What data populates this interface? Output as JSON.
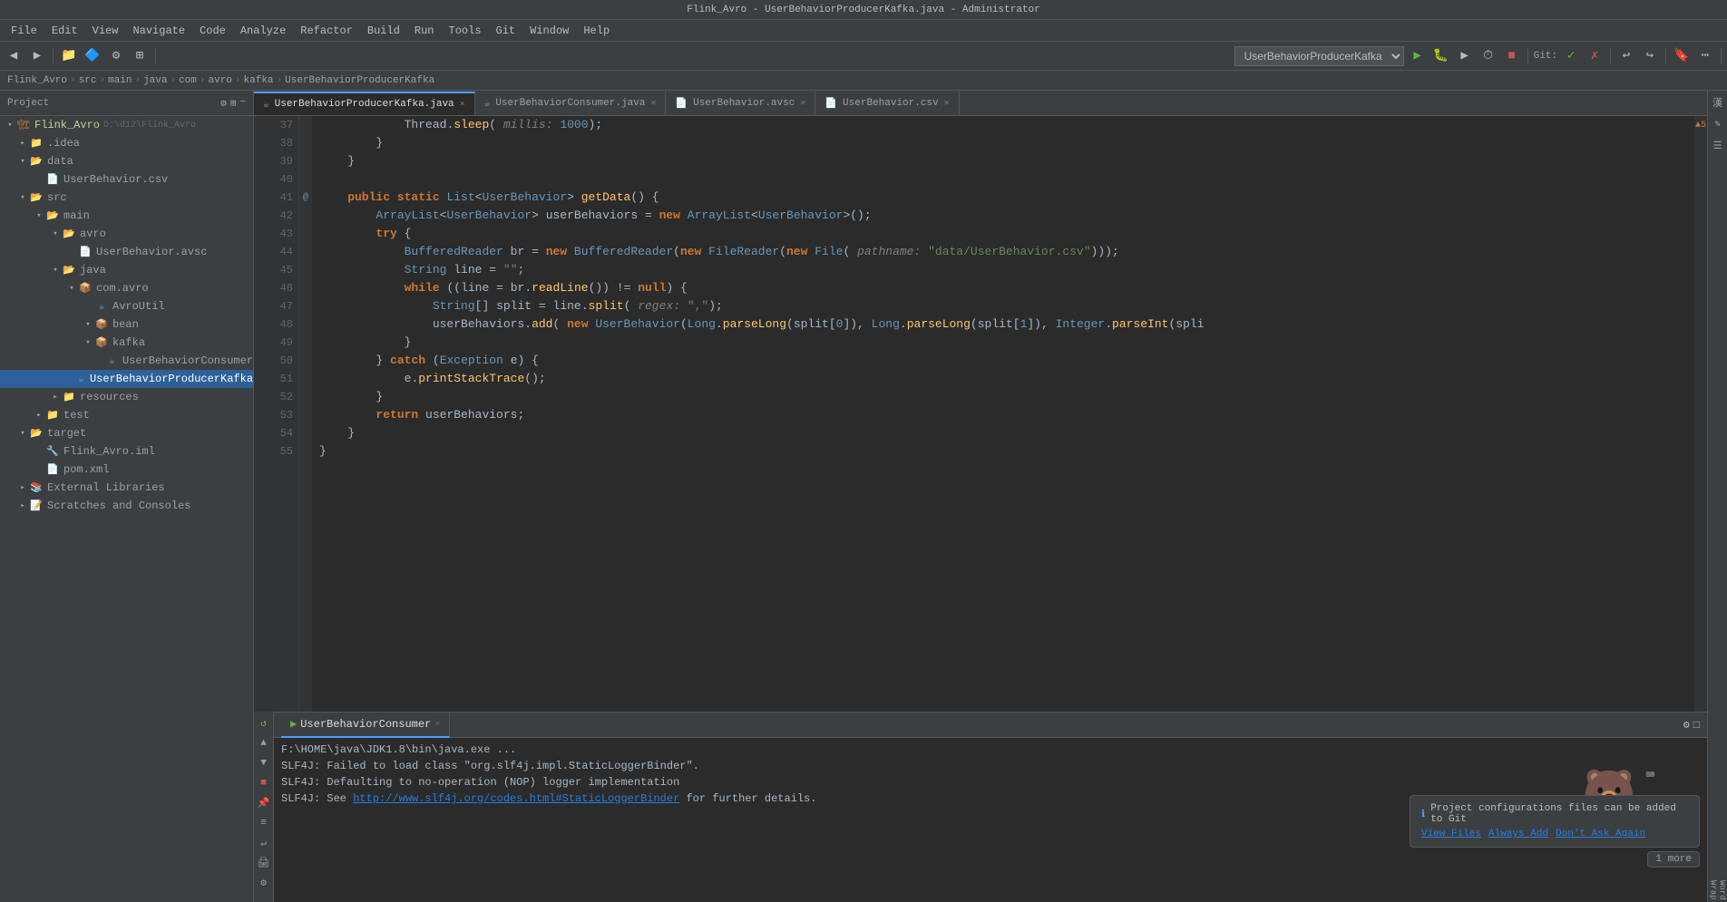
{
  "titleBar": {
    "title": "Flink_Avro - UserBehaviorProducerKafka.java - Administrator"
  },
  "menuBar": {
    "items": [
      "File",
      "Edit",
      "View",
      "Navigate",
      "Code",
      "Analyze",
      "Refactor",
      "Build",
      "Run",
      "Tools",
      "Git",
      "Window",
      "Help"
    ]
  },
  "breadcrumb": {
    "items": [
      "Flink_Avro",
      "src",
      "main",
      "java",
      "com",
      "avro",
      "kafka",
      "UserBehaviorProducerKafka"
    ]
  },
  "sidebar": {
    "header": "Project",
    "tree": [
      {
        "id": "flink_avro",
        "label": "Flink_Avro",
        "path": "D:\\d12\\Flink_Avro",
        "level": 0,
        "expanded": true,
        "type": "project"
      },
      {
        "id": "idea",
        "label": ".idea",
        "level": 1,
        "expanded": false,
        "type": "folder"
      },
      {
        "id": "data",
        "label": "data",
        "level": 1,
        "expanded": true,
        "type": "folder"
      },
      {
        "id": "userbehavior_csv",
        "label": "UserBehavior.csv",
        "level": 2,
        "expanded": false,
        "type": "csv"
      },
      {
        "id": "src",
        "label": "src",
        "level": 1,
        "expanded": true,
        "type": "folder"
      },
      {
        "id": "main",
        "label": "main",
        "level": 2,
        "expanded": true,
        "type": "folder"
      },
      {
        "id": "avro_folder",
        "label": "avro",
        "level": 3,
        "expanded": true,
        "type": "folder"
      },
      {
        "id": "userbehavior_avsc",
        "label": "UserBehavior.avsc",
        "level": 4,
        "expanded": false,
        "type": "avsc"
      },
      {
        "id": "java_folder",
        "label": "java",
        "level": 3,
        "expanded": true,
        "type": "folder"
      },
      {
        "id": "com_folder",
        "label": "com.avro",
        "level": 4,
        "expanded": true,
        "type": "package"
      },
      {
        "id": "avroutil",
        "label": "AvroUtil",
        "level": 5,
        "expanded": false,
        "type": "java"
      },
      {
        "id": "bean",
        "label": "bean",
        "level": 5,
        "expanded": true,
        "type": "package"
      },
      {
        "id": "kafka_pkg",
        "label": "kafka",
        "level": 5,
        "expanded": true,
        "type": "package"
      },
      {
        "id": "userbehaviorconsumer",
        "label": "UserBehaviorConsumer",
        "level": 6,
        "expanded": false,
        "type": "java"
      },
      {
        "id": "userbehaviorproducer",
        "label": "UserBehaviorProducerKafka",
        "level": 6,
        "expanded": false,
        "type": "java",
        "selected": true
      },
      {
        "id": "resources",
        "label": "resources",
        "level": 3,
        "expanded": false,
        "type": "folder"
      },
      {
        "id": "test",
        "label": "test",
        "level": 2,
        "expanded": false,
        "type": "folder"
      },
      {
        "id": "target",
        "label": "target",
        "level": 1,
        "expanded": true,
        "type": "folder"
      },
      {
        "id": "flink_avro_iml",
        "label": "Flink_Avro.iml",
        "level": 2,
        "expanded": false,
        "type": "iml"
      },
      {
        "id": "pom_xml",
        "label": "pom.xml",
        "level": 2,
        "expanded": false,
        "type": "xml"
      },
      {
        "id": "external_libs",
        "label": "External Libraries",
        "level": 1,
        "expanded": false,
        "type": "libs"
      },
      {
        "id": "scratches",
        "label": "Scratches and Consoles",
        "level": 1,
        "expanded": false,
        "type": "scratch"
      }
    ]
  },
  "tabs": [
    {
      "label": "UserBehaviorProducerKafka.java",
      "active": true
    },
    {
      "label": "UserBehaviorConsumer.java",
      "active": false
    },
    {
      "label": "UserBehavior.avsc",
      "active": false
    },
    {
      "label": "UserBehavior.csv",
      "active": false
    }
  ],
  "code": {
    "lines": [
      {
        "num": 37,
        "gutter": "",
        "content": "            Thread.sleep( millis: 1000);"
      },
      {
        "num": 38,
        "gutter": "",
        "content": "        }"
      },
      {
        "num": 39,
        "gutter": "",
        "content": "    }"
      },
      {
        "num": 40,
        "gutter": "",
        "content": ""
      },
      {
        "num": 41,
        "gutter": "@",
        "content": "    public static List<UserBehavior> getData() {"
      },
      {
        "num": 42,
        "gutter": "",
        "content": "        ArrayList<UserBehavior> userBehaviors = new ArrayList<UserBehavior>();"
      },
      {
        "num": 43,
        "gutter": "",
        "content": "        try {"
      },
      {
        "num": 44,
        "gutter": "",
        "content": "            BufferedReader br = new BufferedReader(new FileReader(new File( pathname: \"data/UserBehavior.csv\")));"
      },
      {
        "num": 45,
        "gutter": "",
        "content": "            String line = \"\";"
      },
      {
        "num": 46,
        "gutter": "",
        "content": "            while ((line = br.readLine()) != null) {"
      },
      {
        "num": 47,
        "gutter": "",
        "content": "                String[] split = line.split( regex: \",\");"
      },
      {
        "num": 48,
        "gutter": "",
        "content": "                userBehaviors.add( new UserBehavior(Long.parseLong(split[0]), Long.parseLong(split[1]), Integer.parseInt(spli"
      },
      {
        "num": 49,
        "gutter": "",
        "content": "            }"
      },
      {
        "num": 50,
        "gutter": "",
        "content": "        } catch (Exception e) {"
      },
      {
        "num": 51,
        "gutter": "",
        "content": "            e.printStackTrace();"
      },
      {
        "num": 52,
        "gutter": "",
        "content": "        }"
      },
      {
        "num": 53,
        "gutter": "",
        "content": "        return userBehaviors;"
      },
      {
        "num": 54,
        "gutter": "",
        "content": "    }"
      },
      {
        "num": 55,
        "gutter": "",
        "content": "}"
      }
    ]
  },
  "runPanel": {
    "tabs": [
      "Run: UserBehaviorConsumer"
    ],
    "activeTab": "Run: UserBehaviorConsumer",
    "lines": [
      {
        "text": "F:\\HOME\\java\\JDK1.8\\bin\\java.exe ...",
        "type": "normal"
      },
      {
        "text": "SLF4J: Failed to load class \"org.slf4j.impl.StaticLoggerBinder\".",
        "type": "normal"
      },
      {
        "text": "SLF4J: Defaulting to no-operation (NOP) logger implementation",
        "type": "normal"
      },
      {
        "text": "SLF4J: See ",
        "link": "http://www.slf4j.org/codes.html#StaticLoggerBinder",
        "linkText": "http://www.slf4j.org/codes.html#StaticLoggerBinder",
        "suffix": " for further details.",
        "type": "link"
      }
    ]
  },
  "notification": {
    "text": "Project configurations files can be added to Git",
    "links": [
      "View Files",
      "Always Add",
      "Don't Ask Again"
    ],
    "more": "1 more"
  },
  "toolbar": {
    "projectDropdown": "UserBehaviorProducerKafka",
    "gitLabel": "Git:"
  }
}
